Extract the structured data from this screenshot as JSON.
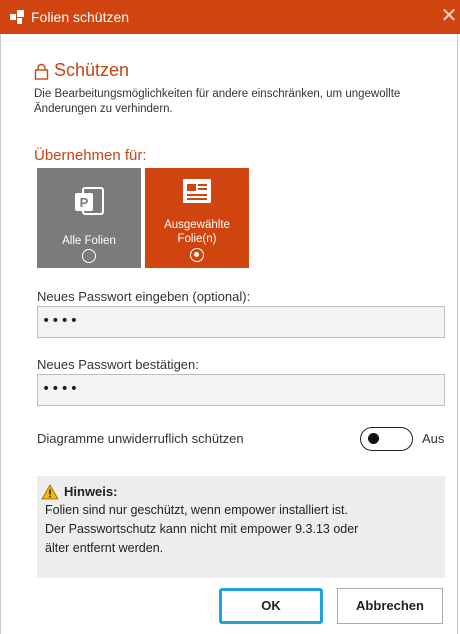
{
  "window": {
    "title": "Folien schützen",
    "accent": "#d04410"
  },
  "section": {
    "heading": "Schützen",
    "description": "Die Bearbeitungsmöglichkeiten für andere einschränken, um ungewollte Änderungen zu verhindern."
  },
  "apply": {
    "label": "Übernehmen für:",
    "options": [
      {
        "label": "Alle Folien",
        "selected": false,
        "icon": "powerpoint-icon"
      },
      {
        "label_line1": "Ausgewählte",
        "label_line2": "Folie(n)",
        "selected": true,
        "icon": "slide-icon"
      }
    ]
  },
  "password": {
    "new_label": "Neues Passwort eingeben (optional):",
    "new_value": "••••",
    "confirm_label": "Neues Passwort bestätigen:",
    "confirm_value": "••••"
  },
  "toggle": {
    "label": "Diagramme unwiderruflich schützen",
    "state": "Aus",
    "on": false
  },
  "hint": {
    "title": "Hinweis:",
    "lines": [
      "Folien sind nur geschützt, wenn empower installiert ist.",
      "Der Passwortschutz kann nicht mit empower 9.3.13 oder",
      "älter entfernt werden."
    ]
  },
  "buttons": {
    "ok": "OK",
    "cancel": "Abbrechen"
  }
}
